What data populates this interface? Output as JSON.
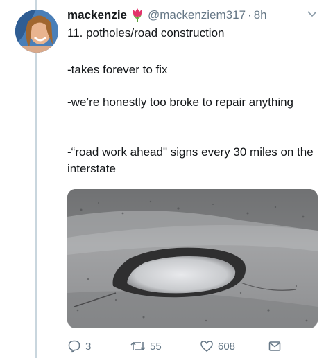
{
  "tweet": {
    "author_name": "mackenzie",
    "author_emoji": "tulip-emoji",
    "handle": "@mackenziem317",
    "separator": "·",
    "time": "8h",
    "lines": [
      "11. potholes/road construction",
      "-takes forever to fix",
      "-we’re honestly too broke to repair anything",
      "-“road work ahead\" signs every 30 miles on the interstate"
    ]
  },
  "actions": {
    "reply_count": "3",
    "retweet_count": "55",
    "like_count": "608"
  },
  "colors": {
    "text": "#14171a",
    "muted": "#657786",
    "thread_line": "#c9d6de"
  }
}
